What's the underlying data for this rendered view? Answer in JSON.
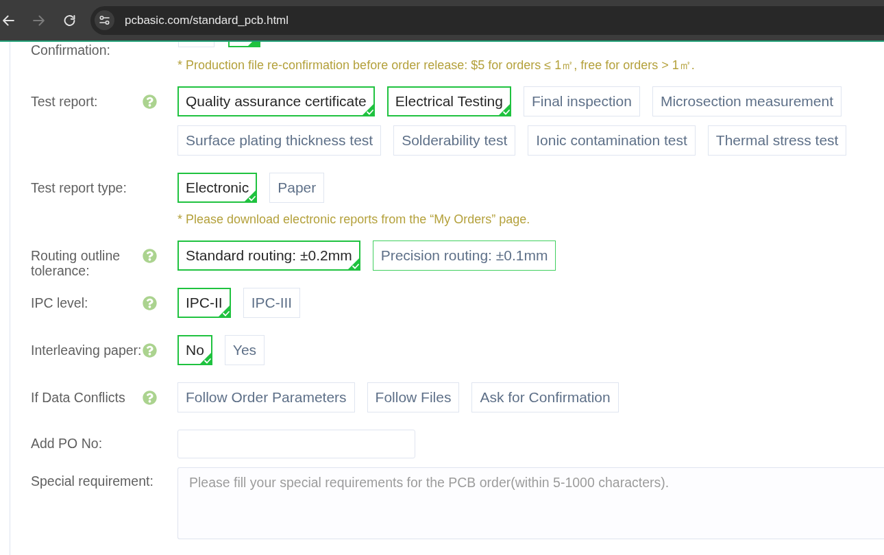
{
  "browser": {
    "nav": [
      {
        "kind": "back",
        "disabled": false
      },
      {
        "kind": "forward",
        "disabled": true
      },
      {
        "kind": "reload",
        "disabled": false
      }
    ],
    "url": "pcbasic.com/standard_pcb.html"
  },
  "form": {
    "rows": [
      {
        "kind": "cut_options",
        "label": "Confirmation:",
        "help": false,
        "options": [
          {
            "selected": false
          },
          {
            "selected": true
          }
        ],
        "note": "* Production file re-confirmation before order release: $5 for orders ≤ 1㎡, free for orders > 1㎡."
      },
      {
        "kind": "options",
        "label": "Test report:",
        "help": true,
        "options": [
          {
            "label": "Quality assurance certificate",
            "selected": true
          },
          {
            "label": "Electrical Testing",
            "selected": true
          },
          {
            "label": "Final inspection",
            "selected": false
          },
          {
            "label": "Microsection measurement",
            "selected": false
          },
          {
            "label": "Surface plating thickness test",
            "selected": false
          },
          {
            "label": "Solderability test",
            "selected": false
          },
          {
            "label": "Ionic contamination test",
            "selected": false
          },
          {
            "label": "Thermal stress test",
            "selected": false
          }
        ]
      },
      {
        "kind": "options",
        "label": "Test report type:",
        "help": false,
        "options": [
          {
            "label": "Electronic",
            "selected": true
          },
          {
            "label": "Paper",
            "selected": false
          }
        ],
        "note": "* Please download electronic reports from the “My Orders” page."
      },
      {
        "kind": "options",
        "label": "Routing outline tolerance:",
        "help": true,
        "options": [
          {
            "label": "Standard routing: ±0.2mm",
            "selected": true,
            "hovered": false
          },
          {
            "label": "Precision routing: ±0.1mm",
            "selected": false,
            "hovered": true
          }
        ]
      },
      {
        "kind": "options",
        "label": "IPC level:",
        "help": true,
        "options": [
          {
            "label": "IPC-II",
            "selected": true
          },
          {
            "label": "IPC-III",
            "selected": false
          }
        ]
      },
      {
        "kind": "options",
        "label": "Interleaving paper:",
        "help": true,
        "options": [
          {
            "label": "No",
            "selected": true
          },
          {
            "label": "Yes",
            "selected": false
          }
        ]
      },
      {
        "kind": "options",
        "label": "If Data Conflicts",
        "help": true,
        "options": [
          {
            "label": "Follow Order Parameters",
            "selected": false
          },
          {
            "label": "Follow Files",
            "selected": false
          },
          {
            "label": "Ask for Confirmation",
            "selected": false
          }
        ]
      },
      {
        "kind": "input",
        "label": "Add PO No:",
        "help": false
      },
      {
        "kind": "textarea",
        "label": "Special requirement:",
        "help": false,
        "placeholder": "Please fill your special requirements for the PCB order(within 5-1000 characters)."
      }
    ]
  }
}
